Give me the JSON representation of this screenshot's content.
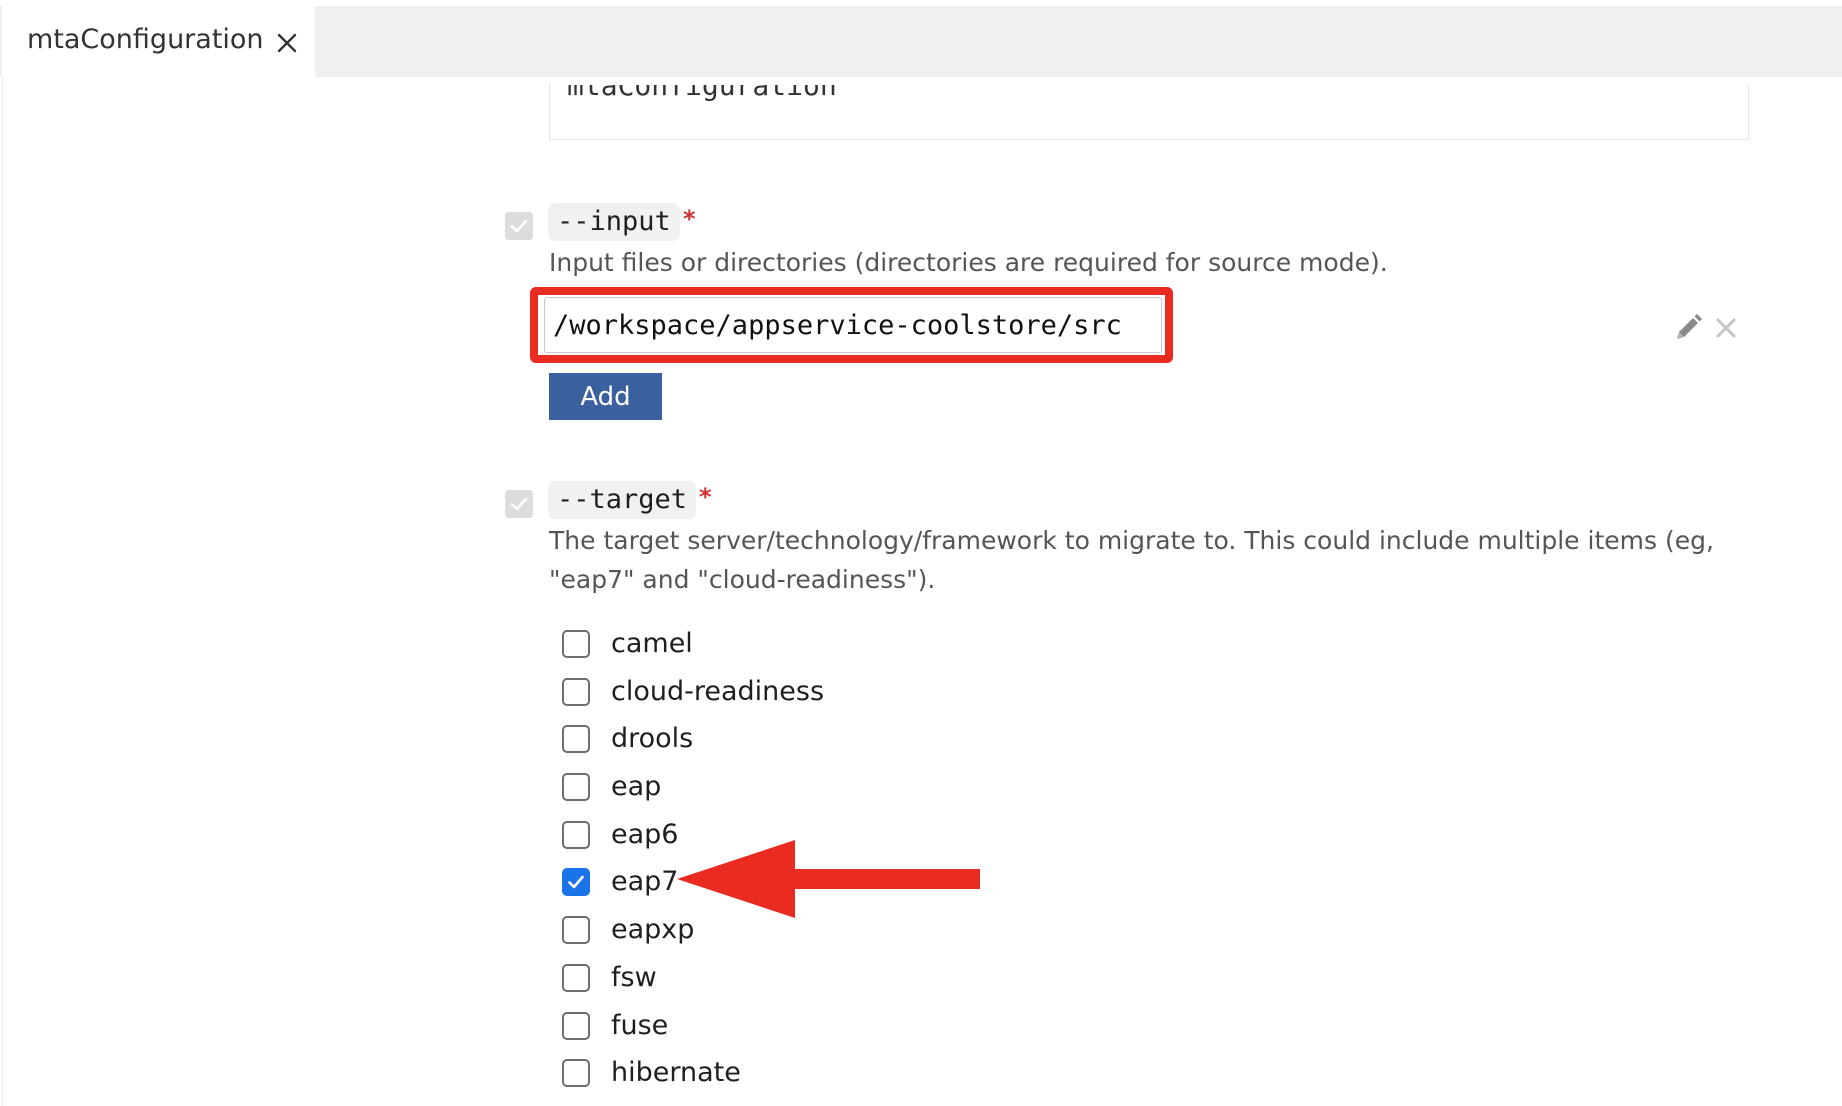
{
  "tab": {
    "title": "mtaConfiguration",
    "close_icon": "close-icon"
  },
  "previous_field": {
    "value": "mtaConfiguration"
  },
  "options": {
    "input": {
      "name": "--input",
      "required_marker": "*",
      "description": "Input files or directories (directories are required for source mode).",
      "value": "/workspace/appservice-coolstore/src",
      "add_label": "Add",
      "enabled": true
    },
    "target": {
      "name": "--target",
      "required_marker": "*",
      "description_line1": "The target server/technology/framework to migrate to. This could include multiple items (eg,",
      "description_line2": "\"eap7\" and \"cloud-readiness\").",
      "enabled": true,
      "items": [
        {
          "label": "camel",
          "checked": false
        },
        {
          "label": "cloud-readiness",
          "checked": false
        },
        {
          "label": "drools",
          "checked": false
        },
        {
          "label": "eap",
          "checked": false
        },
        {
          "label": "eap6",
          "checked": false
        },
        {
          "label": "eap7",
          "checked": true
        },
        {
          "label": "eapxp",
          "checked": false
        },
        {
          "label": "fsw",
          "checked": false
        },
        {
          "label": "fuse",
          "checked": false
        },
        {
          "label": "hibernate",
          "checked": false
        }
      ]
    }
  },
  "annotation": {
    "highlight_color": "#ea2b22",
    "arrow_color": "#ea2b22"
  },
  "colors": {
    "accent_button": "#3a619e",
    "checkbox_checked": "#1a73e8",
    "required": "#d32f2f"
  }
}
